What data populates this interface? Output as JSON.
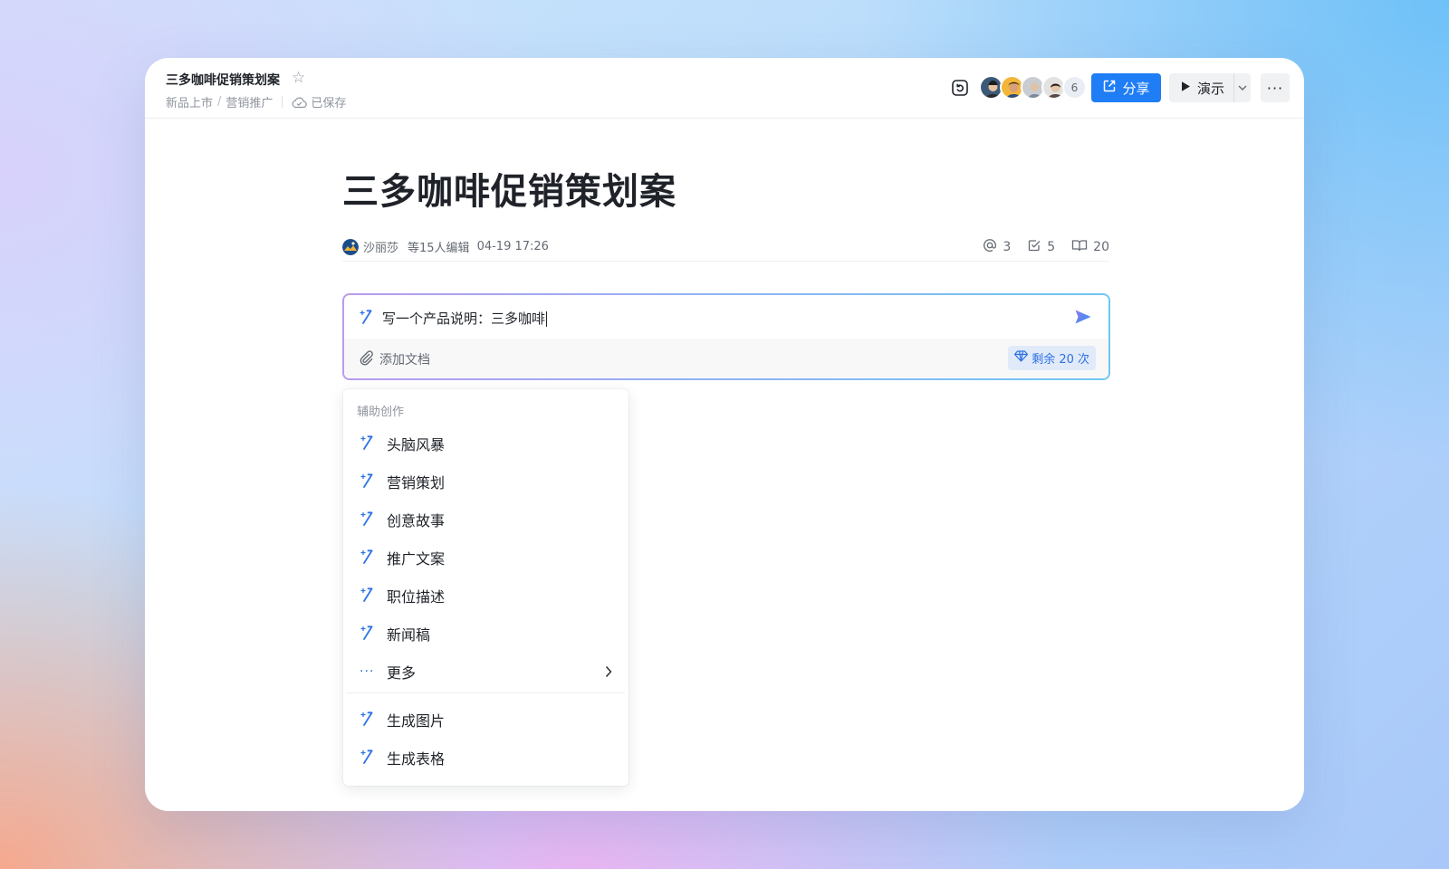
{
  "header": {
    "doc_title": "三多咖啡促销策划案",
    "breadcrumb": [
      "新品上市",
      "营销推广"
    ],
    "saved_status": "已保存",
    "collaborator_extra_count": "6",
    "share_label": "分享",
    "present_label": "演示"
  },
  "document": {
    "heading": "三多咖啡促销策划案",
    "author": "沙丽莎",
    "editors": "等15人编辑",
    "edited_time": "04-19 17:26",
    "stats": {
      "mentions": "3",
      "tasks": "5",
      "reads": "20"
    }
  },
  "ai_prompt": {
    "input_value": "写一个产品说明：三多咖啡",
    "attach_label": "添加文档",
    "quota_label": "剩余 20 次"
  },
  "menu": {
    "section_title": "辅助创作",
    "items": [
      {
        "label": "头脑风暴"
      },
      {
        "label": "营销策划"
      },
      {
        "label": "创意故事"
      },
      {
        "label": "推广文案"
      },
      {
        "label": "职位描述"
      },
      {
        "label": "新闻稿"
      }
    ],
    "more_label": "更多",
    "extra_items": [
      {
        "label": "生成图片"
      },
      {
        "label": "生成表格"
      }
    ]
  },
  "colors": {
    "accent_blue": "#1f7df5",
    "ai_gradient_start": "#b99bef",
    "ai_gradient_end": "#6fc7f3",
    "quota_bg": "#e1eaf9"
  }
}
